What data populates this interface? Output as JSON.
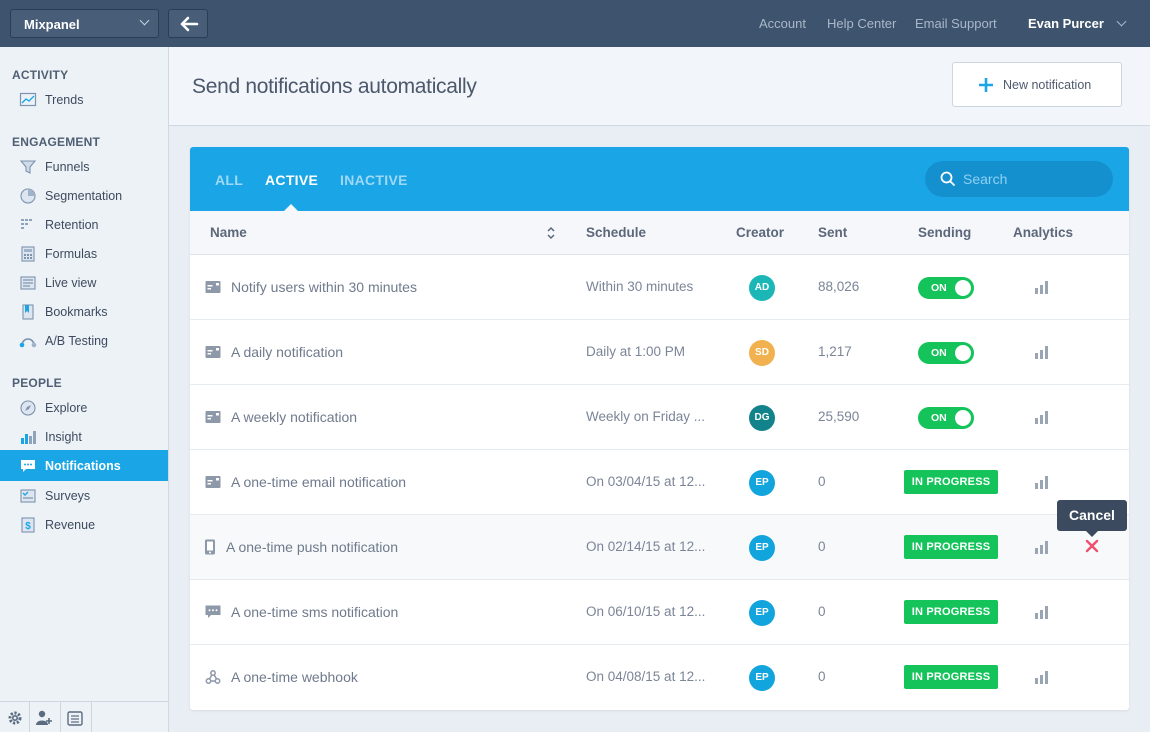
{
  "topbar": {
    "project": "Mixpanel",
    "links": [
      "Account",
      "Help Center",
      "Email Support"
    ],
    "user": "Evan Purcer"
  },
  "sidebar": {
    "sections": [
      {
        "title": "ACTIVITY",
        "items": [
          {
            "label": "Trends",
            "icon": "trends-icon"
          }
        ]
      },
      {
        "title": "ENGAGEMENT",
        "items": [
          {
            "label": "Funnels",
            "icon": "funnel-icon"
          },
          {
            "label": "Segmentation",
            "icon": "pie-icon"
          },
          {
            "label": "Retention",
            "icon": "retention-icon"
          },
          {
            "label": "Formulas",
            "icon": "formula-icon"
          },
          {
            "label": "Live view",
            "icon": "live-view-icon"
          },
          {
            "label": "Bookmarks",
            "icon": "bookmark-icon"
          },
          {
            "label": "A/B Testing",
            "icon": "ab-testing-icon"
          }
        ]
      },
      {
        "title": "PEOPLE",
        "items": [
          {
            "label": "Explore",
            "icon": "explore-icon"
          },
          {
            "label": "Insight",
            "icon": "insight-icon"
          },
          {
            "label": "Notifications",
            "icon": "notifications-icon"
          },
          {
            "label": "Surveys",
            "icon": "survey-icon"
          },
          {
            "label": "Revenue",
            "icon": "revenue-icon"
          }
        ]
      }
    ],
    "active": "Notifications"
  },
  "header": {
    "title": "Send notifications automatically",
    "new_button": "New notification"
  },
  "tabs": [
    "ALL",
    "ACTIVE",
    "INACTIVE"
  ],
  "active_tab": "ACTIVE",
  "search": {
    "placeholder": "Search",
    "value": ""
  },
  "table": {
    "columns": [
      "Name",
      "Schedule",
      "Creator",
      "Sent",
      "Sending",
      "Analytics"
    ],
    "rows": [
      {
        "name": "Notify users within 30 minutes",
        "type": "email",
        "schedule": "Within 30 minutes",
        "creator": "AD",
        "creator_color": "#1bb6b6",
        "sent": "88,026",
        "sending": "ON",
        "sending_kind": "toggle"
      },
      {
        "name": "A daily notification",
        "type": "email",
        "schedule": "Daily at 1:00 PM",
        "creator": "SD",
        "creator_color": "#f0b14e",
        "sent": "1,217",
        "sending": "ON",
        "sending_kind": "toggle"
      },
      {
        "name": "A weekly notification",
        "type": "email",
        "schedule": "Weekly on Friday ...",
        "creator": "DG",
        "creator_color": "#12838a",
        "sent": "25,590",
        "sending": "ON",
        "sending_kind": "toggle"
      },
      {
        "name": "A one-time email notification",
        "type": "email",
        "schedule": "On 03/04/15 at 12...",
        "creator": "EP",
        "creator_color": "#12a4dd",
        "sent": "0",
        "sending": "IN PROGRESS",
        "sending_kind": "badge"
      },
      {
        "name": "A one-time push notification",
        "type": "push",
        "schedule": "On 02/14/15 at 12...",
        "creator": "EP",
        "creator_color": "#12a4dd",
        "sent": "0",
        "sending": "IN PROGRESS",
        "sending_kind": "badge"
      },
      {
        "name": "A one-time sms notification",
        "type": "sms",
        "schedule": "On 06/10/15 at 12...",
        "creator": "EP",
        "creator_color": "#12a4dd",
        "sent": "0",
        "sending": "IN PROGRESS",
        "sending_kind": "badge"
      },
      {
        "name": "A one-time webhook",
        "type": "webhook",
        "schedule": "On 04/08/15 at 12...",
        "creator": "EP",
        "creator_color": "#12a4dd",
        "sent": "0",
        "sending": "IN PROGRESS",
        "sending_kind": "badge"
      }
    ]
  },
  "tooltip": {
    "label": "Cancel"
  },
  "colors": {
    "accent": "#1aa6e6",
    "success": "#14c45b",
    "danger": "#f0506e",
    "topbar": "#3e536d"
  }
}
